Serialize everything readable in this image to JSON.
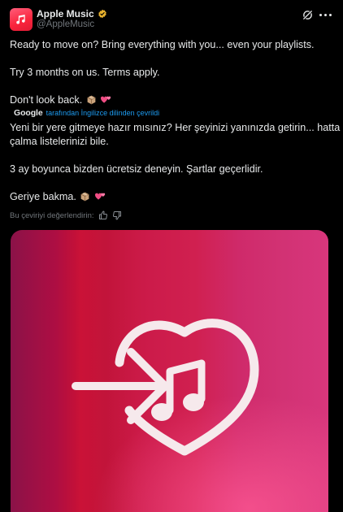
{
  "tweet": {
    "display_name": "Apple Music",
    "handle": "@AppleMusic",
    "original_lines": [
      "Ready to move on? Bring everything with you... even your playlists.",
      "Try 3 months on us. Terms apply.",
      "Don't look back."
    ],
    "google_label": "Google",
    "translated_note": "tarafından İngilizce dilinden çevrildi",
    "translated_lines": [
      "Yeni bir yere gitmeye hazır mısınız? Her şeyinizi yanınızda getirin... hatta",
      "çalma listelerinizi bile.",
      "3 ay boyunca bizden ücretsiz deneyin. Şartlar geçerlidir.",
      "Geriye bakma."
    ],
    "rate_label": "Bu çeviriyi değerlendirin:"
  },
  "colors": {
    "verified_badge": "#e8b22e",
    "accent_link": "#1d9bf0",
    "avatar_red": "#fa243c"
  },
  "icons": {
    "avatar": "music-note-icon",
    "verified": "verified-badge-icon",
    "grok": "grok-icon",
    "more": "more-icon",
    "emoji_box": "package-icon",
    "emoji_hearts": "two-hearts-icon",
    "thumbs_up": "thumbs-up-icon",
    "thumbs_down": "thumbs-down-icon",
    "media_arrow": "arrow-right-icon",
    "media_heart": "heart-icon",
    "media_note": "music-note-icon"
  }
}
